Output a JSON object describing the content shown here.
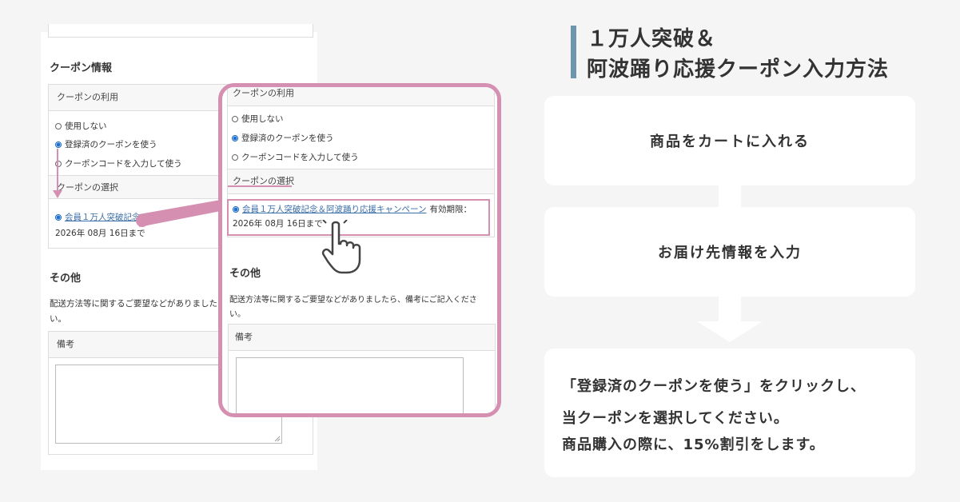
{
  "form": {
    "coupon_section_title": "クーポン情報",
    "coupon_use_header": "クーポンの利用",
    "options": [
      "使用しない",
      "登録済のクーポンを使う",
      "クーポンコードを入力して使う"
    ],
    "coupon_select_header": "クーポンの選択",
    "coupon_name_short": "会員１万人突破記念",
    "coupon_name": "会員１万人突破記念＆阿波踊り応援キャンペーン",
    "expiry_label": "有効期限：",
    "expiry_date": "2026年 08月 16日まで",
    "other_section_title": "その他",
    "other_note_line1_short": "配送方法等に関するご要望などがありましたら",
    "other_note_line1": "配送方法等に関するご要望などがありましたら、備考にご記入くださ",
    "other_note_line2": "い。",
    "remarks_header": "備考"
  },
  "guide": {
    "title_line1": "１万人突破＆",
    "title_line2": "阿波踊り応援クーポン入力方法",
    "step1": "商品をカートに入れる",
    "step2": "お届け先情報を入力",
    "step3_lines": [
      "「登録済のクーポンを使う」をクリックし、",
      "当クーポンを選択してください。",
      "商品購入の際に、15%割引をします。"
    ]
  },
  "colors": {
    "accent_pink": "#d58fb0",
    "title_bar": "#6d95ad",
    "link": "#3b6ea8"
  }
}
